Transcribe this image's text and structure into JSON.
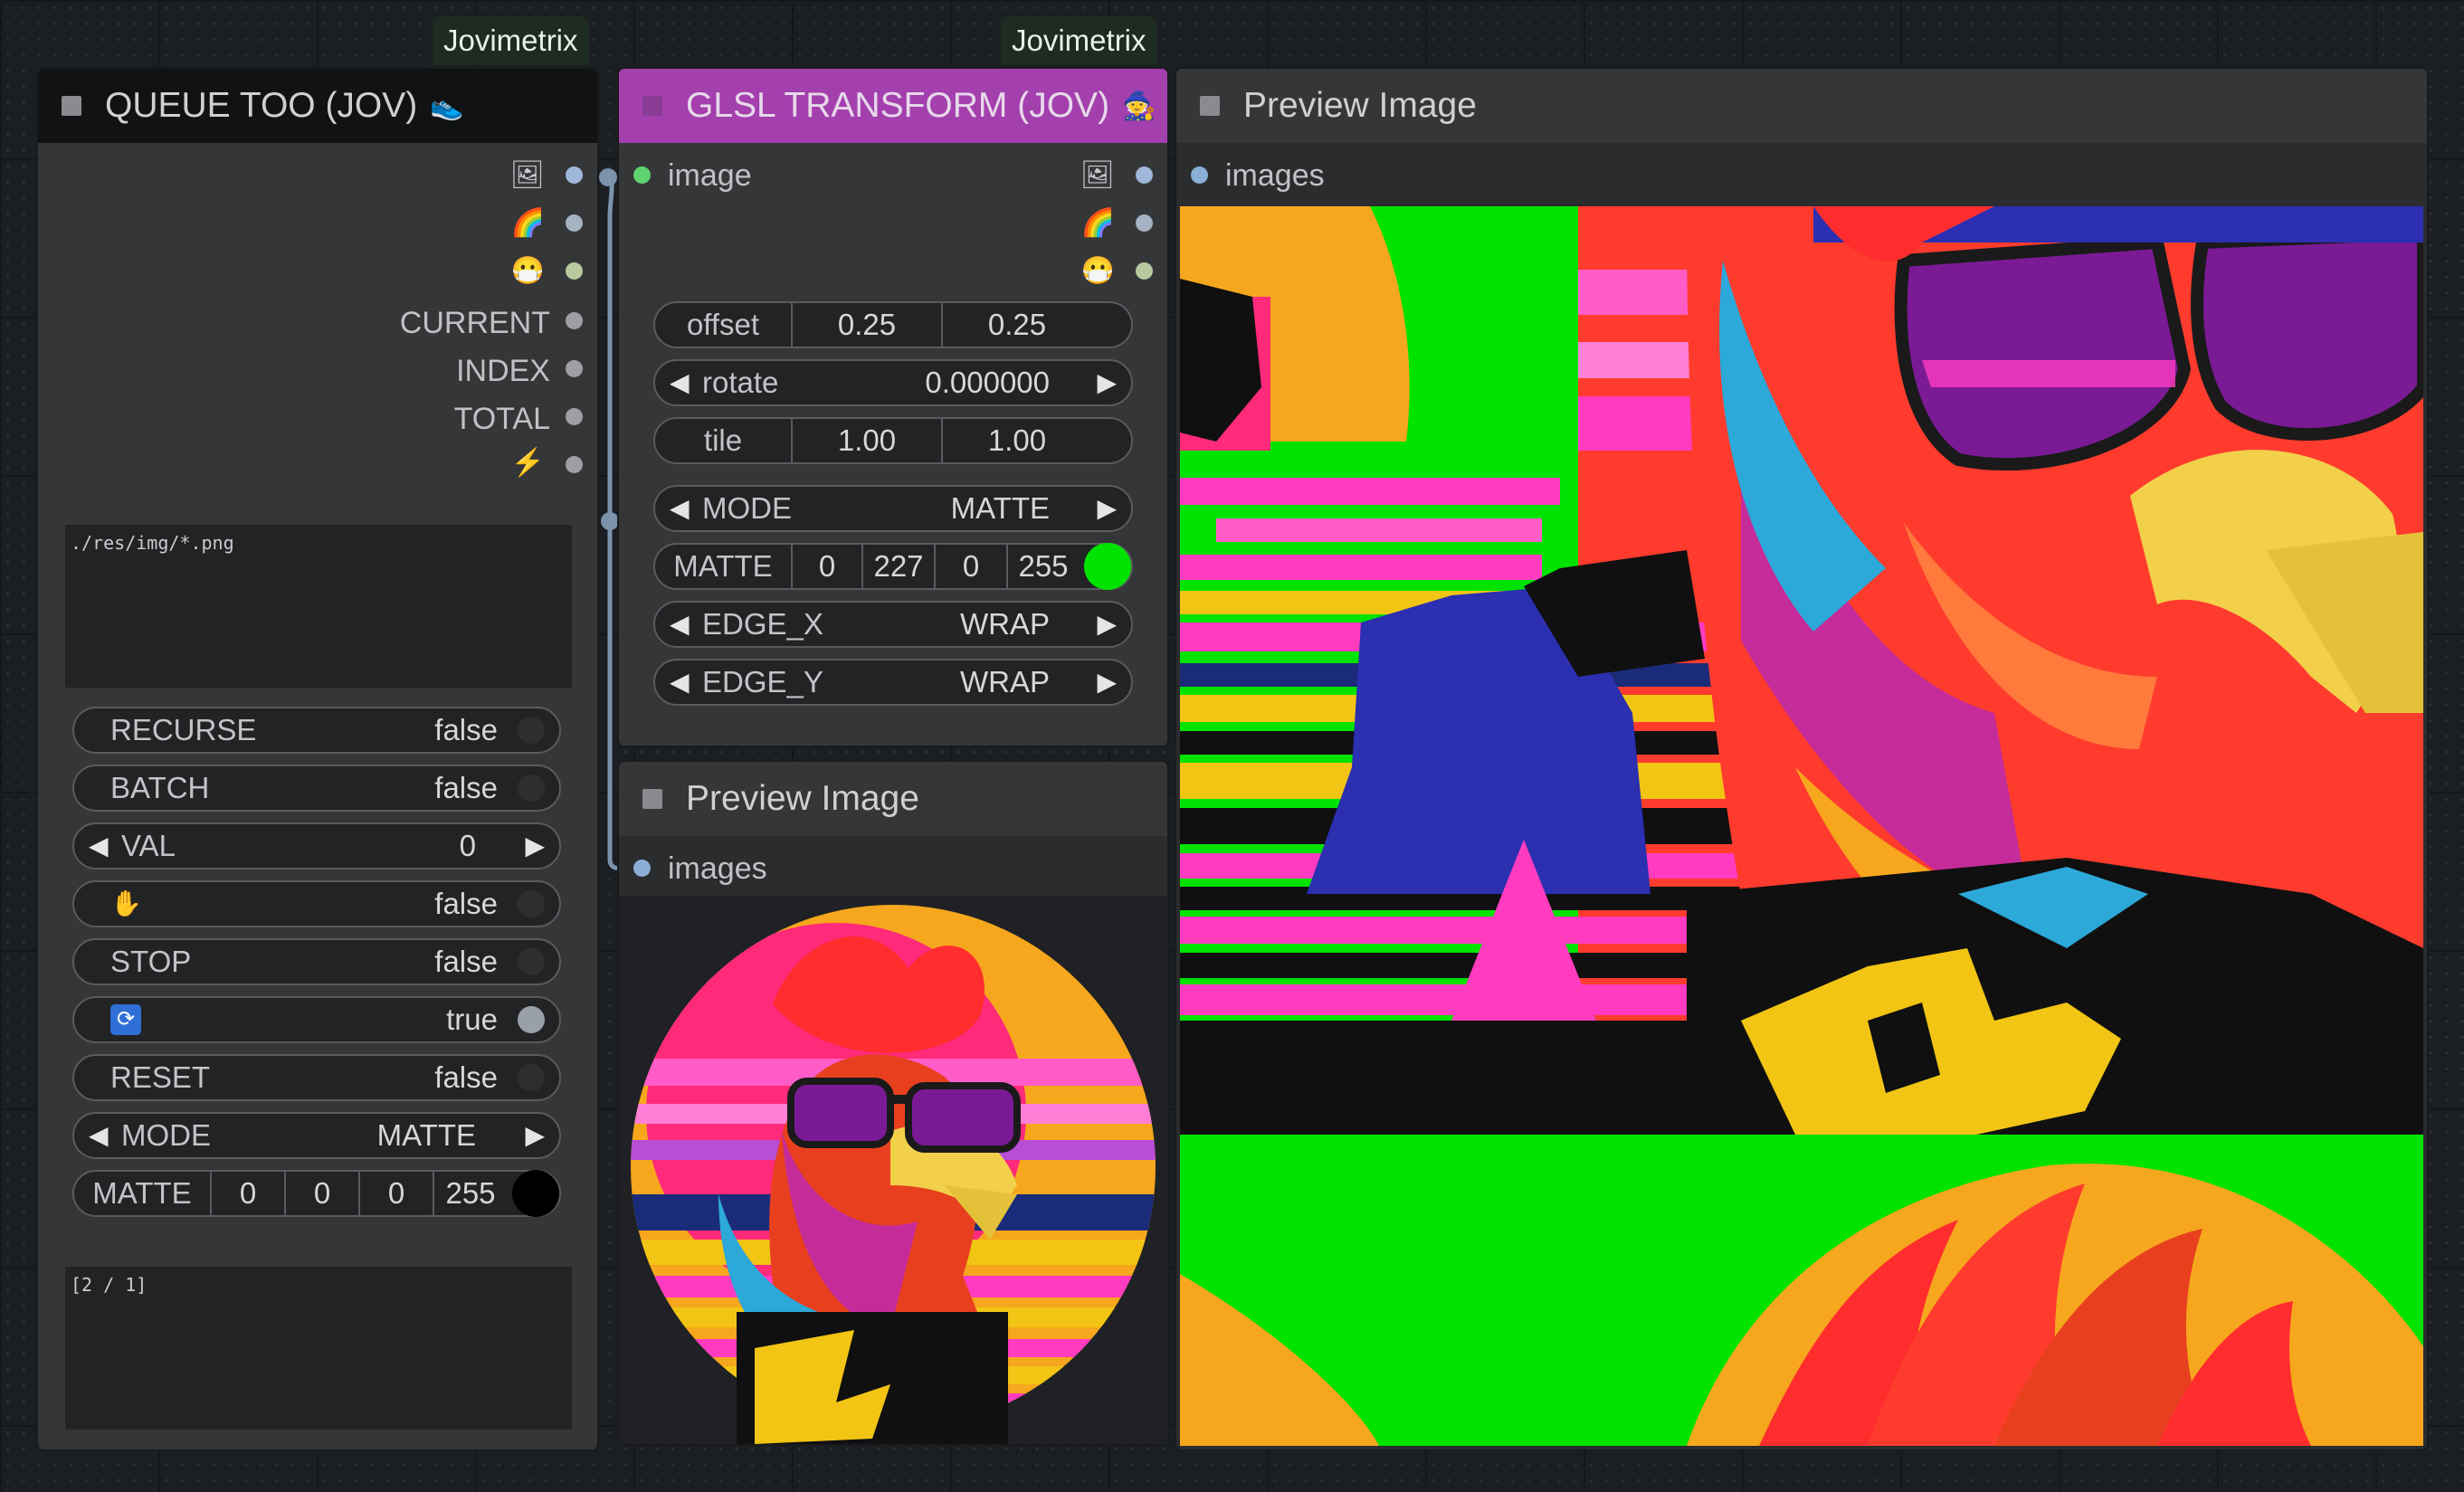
{
  "badges": {
    "left": "Jovimetrix",
    "middle": "Jovimetrix"
  },
  "queue_node": {
    "title": "QUEUE TOO (JOV)",
    "title_icon": "shoe-icon",
    "outputs": [
      {
        "type": "icon",
        "icon": "picture-icon",
        "glyph": "🖼",
        "dot_color": "#9fb7d9"
      },
      {
        "type": "icon",
        "icon": "rainbow-icon",
        "glyph": "🌈",
        "dot_color": "#a4b2c2"
      },
      {
        "type": "icon",
        "icon": "mask-face-icon",
        "glyph": "😷",
        "dot_color": "#b8c9a0"
      },
      {
        "type": "text",
        "label": "CURRENT",
        "dot_color": "#9d9fa2"
      },
      {
        "type": "text",
        "label": "INDEX",
        "dot_color": "#9d9fa2"
      },
      {
        "type": "text",
        "label": "TOTAL",
        "dot_color": "#9d9fa2"
      },
      {
        "type": "icon",
        "icon": "lightning-icon",
        "glyph": "⚡",
        "dot_color": "#9d9fa2"
      }
    ],
    "path_text": "./res/img/*.png",
    "recurse": {
      "label": "RECURSE",
      "value": "false"
    },
    "batch": {
      "label": "BATCH",
      "value": "false"
    },
    "val": {
      "label": "VAL",
      "value": "0"
    },
    "hold": {
      "icon": "hand-icon",
      "glyph": "✋",
      "value": "false"
    },
    "stop": {
      "label": "STOP",
      "value": "false"
    },
    "loop": {
      "icon": "loop-icon",
      "glyph": "🔄",
      "value": "true"
    },
    "reset": {
      "label": "RESET",
      "value": "false"
    },
    "mode": {
      "label": "MODE",
      "value": "MATTE"
    },
    "matte": {
      "label": "MATTE",
      "values": [
        "0",
        "0",
        "0",
        "255"
      ],
      "swatch": "#000000"
    },
    "status_text": "[2 / 1]"
  },
  "glsl_node": {
    "title": "GLSL TRANSFORM (JOV)",
    "title_icon": "wizard-icon",
    "title_bg": "#a43fae",
    "input_label": "image",
    "output_icons": [
      {
        "icon": "picture-icon",
        "glyph": "🖼"
      },
      {
        "icon": "rainbow-icon",
        "glyph": "🌈"
      },
      {
        "icon": "mask-face-icon",
        "glyph": "😷"
      }
    ],
    "offset": {
      "label": "offset",
      "values": [
        "0.25",
        "0.25"
      ]
    },
    "rotate": {
      "label": "rotate",
      "value": "0.000000"
    },
    "tile": {
      "label": "tile",
      "values": [
        "1.00",
        "1.00"
      ]
    },
    "mode": {
      "label": "MODE",
      "value": "MATTE"
    },
    "matte": {
      "label": "MATTE",
      "values": [
        "0",
        "227",
        "0",
        "255"
      ],
      "swatch": "#00e300"
    },
    "edge_x": {
      "label": "EDGE_X",
      "value": "WRAP"
    },
    "edge_y": {
      "label": "EDGE_Y",
      "value": "WRAP"
    }
  },
  "preview_small": {
    "title": "Preview Image",
    "input_label": "images"
  },
  "preview_large": {
    "title": "Preview Image",
    "input_label": "images"
  },
  "colors": {
    "link": "#7b93ad",
    "green_dot": "#5fd36f",
    "blue_dot": "#8aaed6"
  }
}
